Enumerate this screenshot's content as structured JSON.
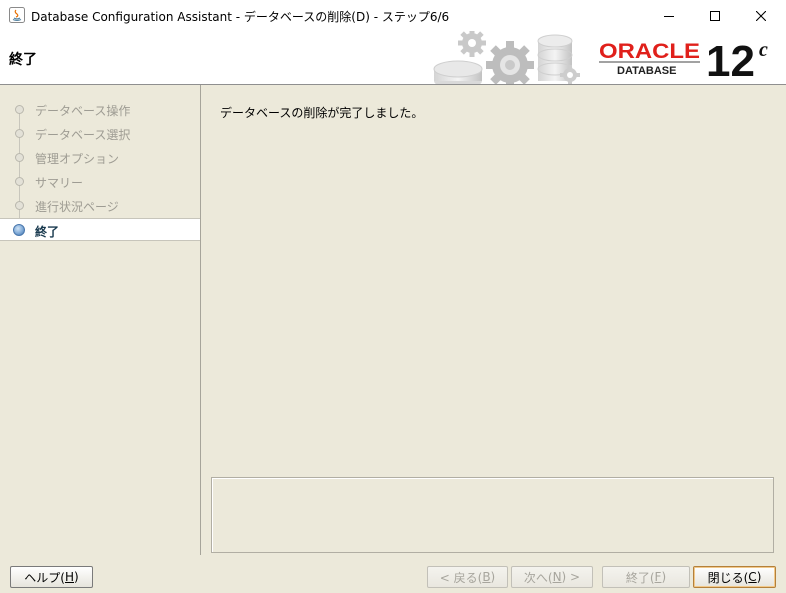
{
  "window": {
    "title": "Database Configuration Assistant - データベースの削除(D) - ステップ6/6"
  },
  "header": {
    "title": "終了",
    "logo_text": "ORACLE",
    "logo_sub": "DATABASE",
    "version": "12",
    "version_suffix": "c"
  },
  "steps": [
    {
      "label": "データベース操作",
      "state": "done"
    },
    {
      "label": "データベース選択",
      "state": "done"
    },
    {
      "label": "管理オプション",
      "state": "done"
    },
    {
      "label": "サマリー",
      "state": "done"
    },
    {
      "label": "進行状況ページ",
      "state": "done"
    },
    {
      "label": "終了",
      "state": "active"
    }
  ],
  "content": {
    "message": "データベースの削除が完了しました。"
  },
  "buttons": {
    "help": {
      "text": "ヘルプ(",
      "key": "H",
      "end": ")"
    },
    "back": {
      "text": "< 戻る(",
      "key": "B",
      "end": ")"
    },
    "next": {
      "text": "次へ(",
      "key": "N",
      "end": ") >"
    },
    "finish": {
      "text": "終了(",
      "key": "F",
      "end": ")"
    },
    "close": {
      "text": "閉じる(",
      "key": "C",
      "end": ")"
    }
  },
  "colors": {
    "oracle_red": "#e0201b",
    "panel_bg": "#ece9da",
    "active_step_text": "#17384d"
  }
}
